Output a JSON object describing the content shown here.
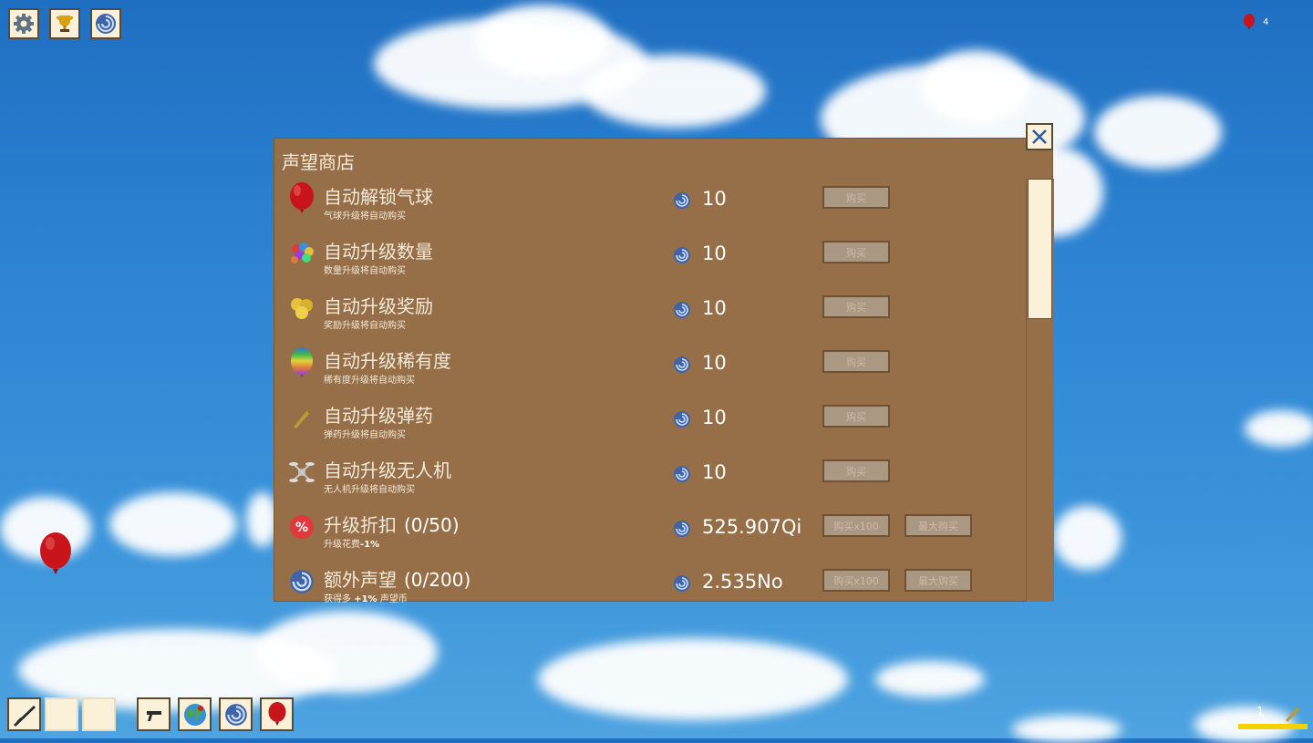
{
  "hud": {
    "balloon_count": "4",
    "ammo_count": "1",
    "ammo_fill": 1.0
  },
  "top_buttons": [
    {
      "name": "settings-button",
      "icon": "gear-icon"
    },
    {
      "name": "achievements-button",
      "icon": "trophy-icon"
    },
    {
      "name": "prestige-button",
      "icon": "prestige-swirl-icon"
    }
  ],
  "shop": {
    "title": "声望商店",
    "currency_icon": "prestige-coin-icon",
    "rows": [
      {
        "icon": "red-balloon-icon",
        "name": "自动解锁气球",
        "level": "",
        "desc": "气球升级将自动购买",
        "desc_bold": "",
        "desc_after": "",
        "price": "10",
        "btn1": "购买",
        "btn2": ""
      },
      {
        "icon": "balloon-bunch-icon",
        "name": "自动升级数量",
        "level": "",
        "desc": "数量升级将自动购买",
        "desc_bold": "",
        "desc_after": "",
        "price": "10",
        "btn1": "购买",
        "btn2": ""
      },
      {
        "icon": "gold-balloons-icon",
        "name": "自动升级奖励",
        "level": "",
        "desc": "奖励升级将自动购买",
        "desc_bold": "",
        "desc_after": "",
        "price": "10",
        "btn1": "购买",
        "btn2": ""
      },
      {
        "icon": "rainbow-balloon-icon",
        "name": "自动升级稀有度",
        "level": "",
        "desc": "稀有度升级将自动购买",
        "desc_bold": "",
        "desc_after": "",
        "price": "10",
        "btn1": "购买",
        "btn2": ""
      },
      {
        "icon": "bullet-icon",
        "name": "自动升级弹药",
        "level": "",
        "desc": "弹药升级将自动购买",
        "desc_bold": "",
        "desc_after": "",
        "price": "10",
        "btn1": "购买",
        "btn2": ""
      },
      {
        "icon": "drone-icon",
        "name": "自动升级无人机",
        "level": "",
        "desc": "无人机升级将自动购买",
        "desc_bold": "",
        "desc_after": "",
        "price": "10",
        "btn1": "购买",
        "btn2": ""
      },
      {
        "icon": "discount-percent-icon",
        "name": "升级折扣",
        "level": "(0/50)",
        "desc": "升级花费",
        "desc_bold": "-1%",
        "desc_after": "",
        "price": "525.907Qi",
        "btn1": "购买x100",
        "btn2": "最大购买"
      },
      {
        "icon": "prestige-swirl-icon",
        "name": "额外声望",
        "level": "(0/200)",
        "desc": "获得多 ",
        "desc_bold": "+1%",
        "desc_after": " 声望币",
        "price": "2.535No",
        "btn1": "购买x100",
        "btn2": "最大购买"
      }
    ]
  },
  "bottom_bar": [
    {
      "name": "weapon-slot-rifle",
      "icon": "rifle-icon"
    },
    {
      "name": "weapon-slot-empty-1",
      "icon": ""
    },
    {
      "name": "weapon-slot-empty-2",
      "icon": ""
    },
    {
      "name": "pistol-button",
      "icon": "pistol-icon"
    },
    {
      "name": "world-map-button",
      "icon": "globe-icon"
    },
    {
      "name": "prestige-shop-button",
      "icon": "prestige-swirl-icon"
    },
    {
      "name": "balloon-button",
      "icon": "red-balloon-icon"
    }
  ]
}
